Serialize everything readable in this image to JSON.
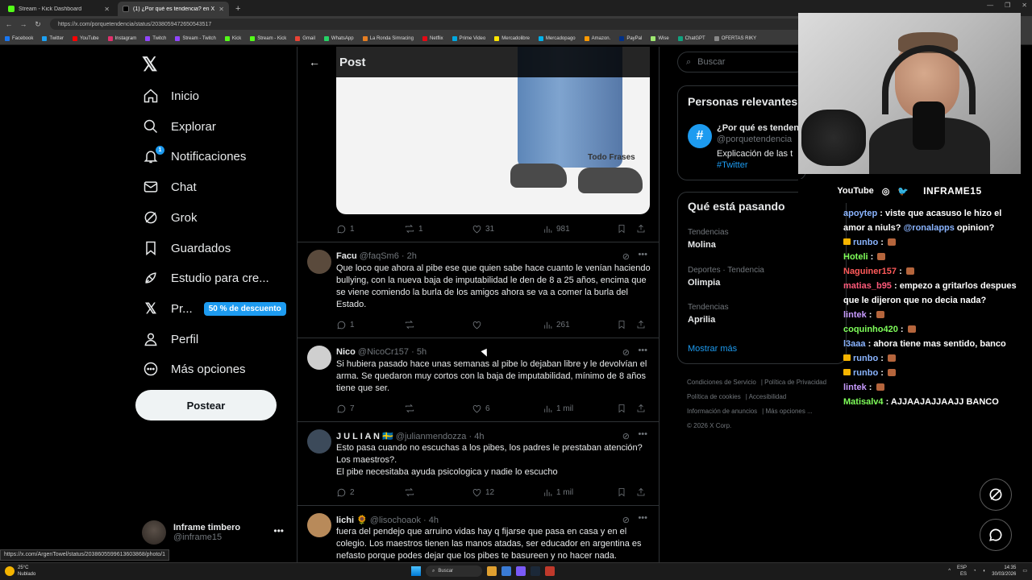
{
  "browser": {
    "tabs": [
      {
        "label": "Stream - Kick Dashboard",
        "active": false
      },
      {
        "label": "(1) ¿Por qué es tendencia? en X: \"",
        "active": true
      }
    ],
    "url": "https://x.com/porquetendencia/status/2038059472650543517",
    "bookmarks": [
      "Facebook",
      "Twitter",
      "YouTube",
      "Instagram",
      "Twitch",
      "Stream - Twitch",
      "Kick",
      "Stream - Kick",
      "Gmail",
      "WhatsApp",
      "La Ronda Simracing",
      "Netflix",
      "Prime Video",
      "Mercadolibre",
      "Mercadopago",
      "Amazon.",
      "PayPal",
      "Wise",
      "ChatGPT",
      "OFERTAS RIKY"
    ],
    "status_url": "https://x.com/ArgenTowel/status/2038605599613603868/photo/1"
  },
  "nav": {
    "items": [
      {
        "label": "Inicio",
        "icon": "home-icon"
      },
      {
        "label": "Explorar",
        "icon": "search-icon"
      },
      {
        "label": "Notificaciones",
        "icon": "bell-icon",
        "badge": "1"
      },
      {
        "label": "Chat",
        "icon": "mail-icon"
      },
      {
        "label": "Grok",
        "icon": "grok-icon"
      },
      {
        "label": "Guardados",
        "icon": "bookmark-icon"
      },
      {
        "label": "Estudio para cre...",
        "icon": "rocket-icon"
      },
      {
        "label": "Pr...",
        "icon": "x-premium-icon",
        "promo": "50 % de descuento"
      },
      {
        "label": "Perfil",
        "icon": "person-icon"
      },
      {
        "label": "Más opciones",
        "icon": "more-circle-icon"
      }
    ],
    "post_button": "Postear",
    "account": {
      "name": "Inframe timbero",
      "handle": "@inframe15"
    }
  },
  "post": {
    "header_title": "Post",
    "media_watermark": "Todo Frases",
    "main_stats": {
      "replies": "1",
      "reposts": "1",
      "likes": "31",
      "views": "981"
    }
  },
  "replies": [
    {
      "name": "Facu",
      "handle": "@faqSm6",
      "time": "2h",
      "text": "Que loco que ahora al pibe ese que quien sabe hace cuanto le venían haciendo bullying, con la nueva baja de imputabilidad le den de 8 a 25 años, encima que se viene comiendo la burla de los amigos ahora se va a comer la burla del Estado.",
      "replies": "1",
      "reposts": "",
      "likes": "",
      "views": "261",
      "avatar_color": "#5a4a3c"
    },
    {
      "name": "Nico",
      "handle": "@NicoCr157",
      "time": "5h",
      "text": "Si hubiera pasado hace unas semanas al pibe lo dejaban libre y le devolvían el arma. Se quedaron muy cortos con la baja de imputabilidad, mínimo de 8 años tiene que ser.",
      "replies": "7",
      "reposts": "",
      "likes": "6",
      "views": "1 mil",
      "avatar_color": "#cfcfcf"
    },
    {
      "name": "J U L I A N 🇸🇪",
      "handle": "@julianmendozza",
      "time": "4h",
      "text": "Esto pasa cuando no escuchas a los pibes, los padres le prestaban atención? Los maestros?.\nEl pibe necesitaba ayuda psicologica y nadie lo escucho",
      "replies": "2",
      "reposts": "",
      "likes": "12",
      "views": "1 mil",
      "avatar_color": "#3c4a5a"
    },
    {
      "name": "lichi 🌻",
      "handle": "@lisochoaok",
      "time": "4h",
      "text": "fuera del pendejo que arruino vidas hay q fijarse que pasa en casa y en el colegio. Los maestros tienen las manos atadas, ser educador en argentina es nefasto porque podes dejar que los pibes te basureen y no hacer nada.",
      "replies": "",
      "reposts": "",
      "likes": "",
      "views": "",
      "avatar_color": "#b88a5a"
    }
  ],
  "right": {
    "search_placeholder": "Buscar",
    "relevant_title": "Personas relevantes",
    "relevant_account": {
      "name": "¿Por qué es tenden",
      "handle": "@porquetendencia",
      "bio": "Explicación de las t",
      "tag": "#Twitter"
    },
    "happening_title": "Qué está pasando",
    "trends": [
      {
        "context": "Tendencias",
        "name": "Molina"
      },
      {
        "context": "Deportes · Tendencia",
        "name": "Olimpia"
      },
      {
        "context": "Tendencias",
        "name": "Aprilia"
      }
    ],
    "show_more": "Mostrar más",
    "footer_links": [
      "Condiciones de Servicio",
      "Política de Privacidad",
      "Política de cookies",
      "Accesibilidad",
      "Información de anuncios",
      "Más opciones ...",
      "© 2026 X Corp."
    ]
  },
  "overlay": {
    "socials": [
      "YouTube",
      "instagram-icon",
      "twitter-icon"
    ],
    "streamer": "INFRAME15",
    "chat": [
      {
        "user": "apoytep",
        "user_color": "#8ab4ff",
        "text": "viste que acasuso le hizo el amor a niuls? @ronalapps opinion?",
        "mention": "@ronalapps"
      },
      {
        "user": "runbo",
        "user_color": "#8ab4ff",
        "text": "",
        "emote": true,
        "crown": true
      },
      {
        "user": "Hoteli",
        "user_color": "#7fff5a",
        "text": "",
        "emote": true
      },
      {
        "user": "Naguiner157",
        "user_color": "#ff5a5a",
        "text": "",
        "emote": true
      },
      {
        "user": "matias_b95",
        "user_color": "#ff5a7a",
        "text": "empezo a gritarlos despues que le dijeron que no decia nada?"
      },
      {
        "user": "lintek",
        "user_color": "#c89bff",
        "text": "",
        "emote": true
      },
      {
        "user": "coquinho420",
        "user_color": "#7fff5a",
        "text": "",
        "emote": true
      },
      {
        "user": "l3aaa",
        "user_color": "#8ab4ff",
        "text": "ahora tiene mas sentido, banco"
      },
      {
        "user": "runbo",
        "user_color": "#8ab4ff",
        "text": "",
        "emote": true,
        "crown": true
      },
      {
        "user": "runbo",
        "user_color": "#8ab4ff",
        "text": "",
        "emote": true,
        "crown": true
      },
      {
        "user": "lintek",
        "user_color": "#c89bff",
        "text": "",
        "emote": true
      },
      {
        "user": "Matisalv4",
        "user_color": "#7fff5a",
        "text": "AJJAAJAJJAAJJ BANCO"
      }
    ]
  },
  "taskbar": {
    "weather_temp": "25°C",
    "weather_desc": "Nublado",
    "search_label": "Buscar",
    "lang": "ESP",
    "lang_sub": "ES",
    "time": "14:35",
    "date": "30/03/2026"
  }
}
